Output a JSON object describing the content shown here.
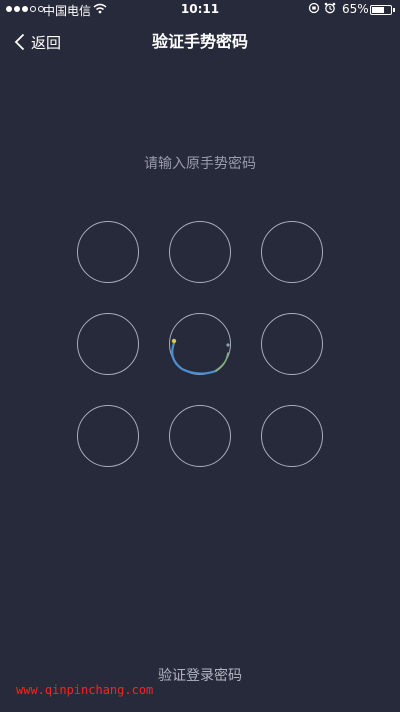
{
  "status_bar": {
    "carrier": "中国电信",
    "time": "10:11",
    "battery_percent": "65%",
    "battery_level": 0.65
  },
  "nav": {
    "back_label": "返回",
    "title": "验证手势密码"
  },
  "gesture": {
    "prompt": "请输入原手势密码"
  },
  "footer": {
    "login_link": "验证登录密码",
    "watermark": "www.qinpinchang.com"
  }
}
